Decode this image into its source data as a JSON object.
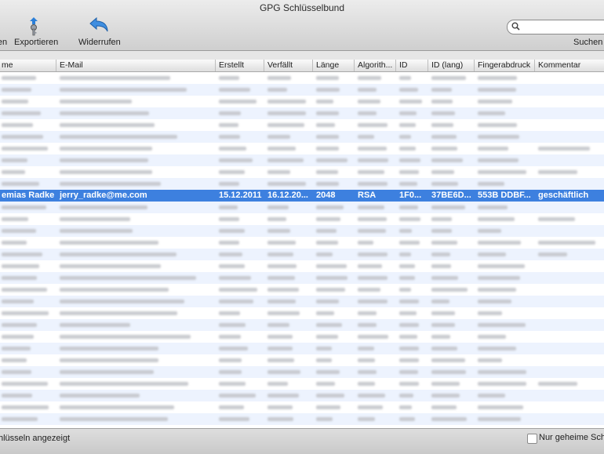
{
  "window": {
    "title": "GPG Schlüsselbund"
  },
  "toolbar": {
    "items": [
      {
        "label": "en",
        "icon": "cut-off-icon"
      },
      {
        "label": "Exportieren",
        "icon": "export-key-icon"
      },
      {
        "label": "Widerrufen",
        "icon": "revoke-arrow-icon"
      }
    ],
    "search": {
      "placeholder": "",
      "value": "",
      "label": "Suchen"
    }
  },
  "table": {
    "columns": [
      "me",
      "E-Mail",
      "Erstellt",
      "Verfällt",
      "Länge",
      "Algorith...",
      "ID",
      "ID (lang)",
      "Fingerabdruck",
      "Kommentar"
    ],
    "rows_above_selected": 10,
    "rows_below_selected": 19,
    "selected_row": {
      "name": "emias Radke",
      "email": "jerry_radke@me.com",
      "created": "15.12.2011",
      "expires": "16.12.20...",
      "length": "2048",
      "algorithm": "RSA",
      "id": "1F0...",
      "id_long": "37BE6D...",
      "fingerprint": "553B DDBF...",
      "comment": "geschäftlich"
    }
  },
  "status": {
    "text": "hlüsseln angezeigt",
    "checkbox_label": "Nur geheime Sch",
    "checkbox_checked": false
  },
  "colors": {
    "selection": "#3d80df",
    "stripe": "#edf3fe"
  }
}
